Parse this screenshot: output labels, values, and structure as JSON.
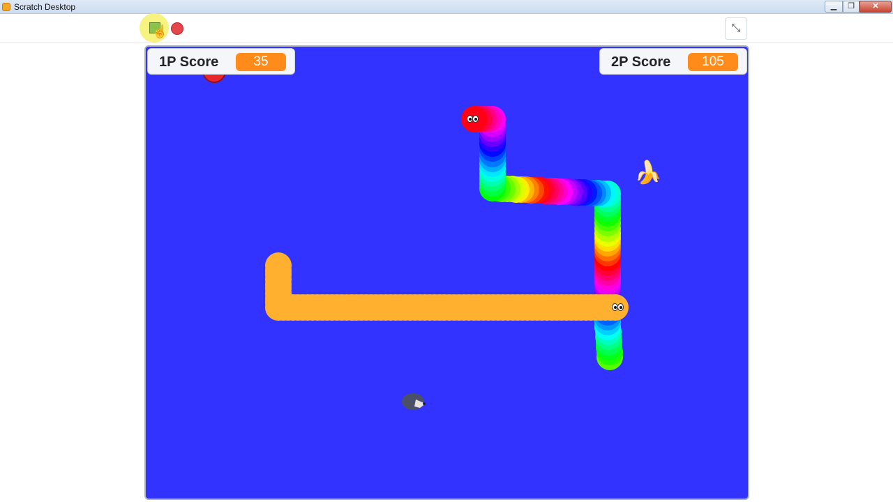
{
  "window": {
    "title": "Scratch Desktop",
    "min_glyph": "▁",
    "max_glyph": "❐",
    "close_glyph": "✕"
  },
  "toolbar": {
    "green_flag_icon": "green-flag-icon",
    "stop_icon": "stop-icon",
    "unfullscreen_glyph": "⤡",
    "cursor_glyph": "☝"
  },
  "stage": {
    "background": "#3333ff",
    "player1": {
      "label": "1P Score",
      "score": "35"
    },
    "player2": {
      "label": "2P Score",
      "score": "105"
    },
    "sprites": {
      "banana_glyph": "🍌"
    }
  },
  "colors": {
    "score_badge": "#ff8c1a",
    "snake_yellow": "#ffb02e",
    "apple": "#e8262e"
  }
}
